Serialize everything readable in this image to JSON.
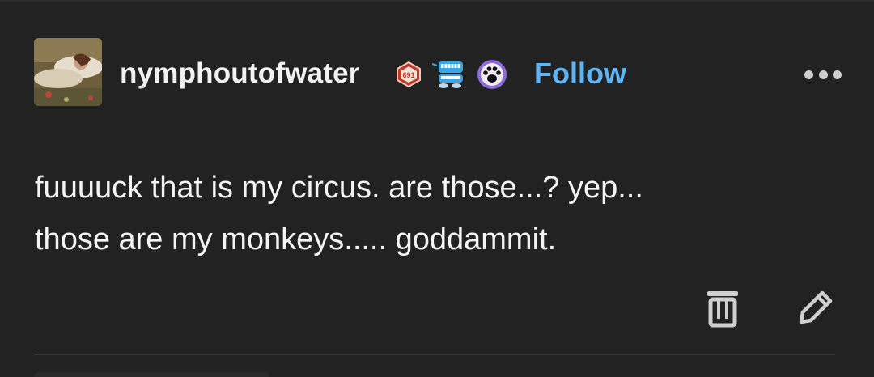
{
  "post": {
    "author": {
      "username": "nymphoutofwater",
      "avatar": "painting-avatar"
    },
    "badges": [
      {
        "icon": "d20-die-badge-icon",
        "label": "691",
        "color": "#c0392b"
      },
      {
        "icon": "chattering-teeth-badge-icon",
        "color": "#3aa6e6"
      },
      {
        "icon": "paw-print-badge-icon",
        "color": "#8e6ad8"
      }
    ],
    "follow_label": "Follow",
    "more_icon": "more-dots-icon",
    "body_lines": [
      "fuuuuck that is my circus. are those...? yep...",
      "those are my monkeys..... goddammit."
    ],
    "actions": {
      "delete_icon": "trash-icon",
      "edit_icon": "pencil-icon"
    }
  },
  "colors": {
    "background": "#222223",
    "text": "#f4f4f4",
    "follow": "#5fb4f5",
    "icon": "#cfcfcf"
  }
}
